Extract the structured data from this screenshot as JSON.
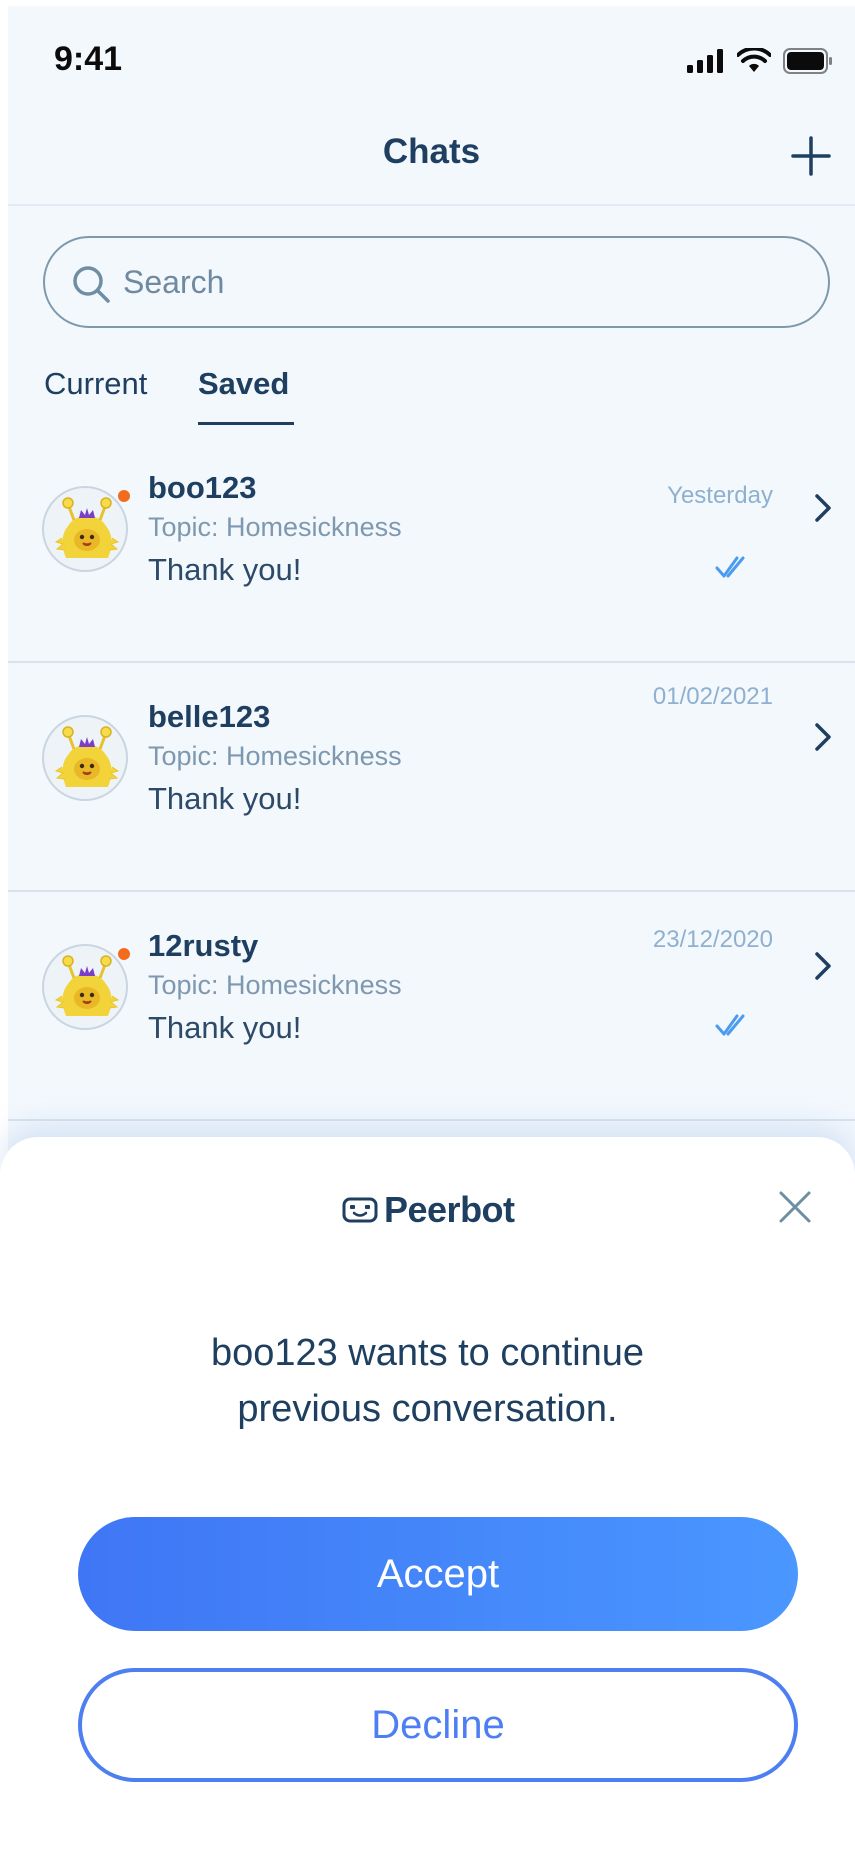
{
  "status_bar": {
    "time": "9:41",
    "icons": [
      "cellular-signal-icon",
      "wifi-icon",
      "battery-icon"
    ]
  },
  "header": {
    "title": "Chats",
    "add_icon": "plus-icon"
  },
  "search": {
    "placeholder": "Search",
    "value": ""
  },
  "tabs": [
    {
      "label": "Current",
      "selected": false
    },
    {
      "label": "Saved",
      "selected": true
    }
  ],
  "chats": [
    {
      "name": "boo123",
      "topic": "Topic: Homesickness",
      "message": "Thank you!",
      "date": "Yesterday",
      "online": true,
      "read": true
    },
    {
      "name": "belle123",
      "topic": "Topic: Homesickness",
      "message": "Thank you!",
      "date": "01/02/2021",
      "online": false,
      "read": false
    },
    {
      "name": "12rusty",
      "topic": "Topic: Homesickness",
      "message": "Thank you!",
      "date": "23/12/2020",
      "online": true,
      "read": true
    }
  ],
  "modal": {
    "brand": "Peerbot",
    "message_line1": "boo123 wants to continue",
    "message_line2": "previous conversation.",
    "accept_label": "Accept",
    "decline_label": "Decline"
  },
  "colors": {
    "background": "#f3f8fd",
    "primary_text": "#1f3f61",
    "accent_blue": "#4a8af7",
    "online_dot": "#f36b1c",
    "read_check": "#4a9cf0"
  }
}
